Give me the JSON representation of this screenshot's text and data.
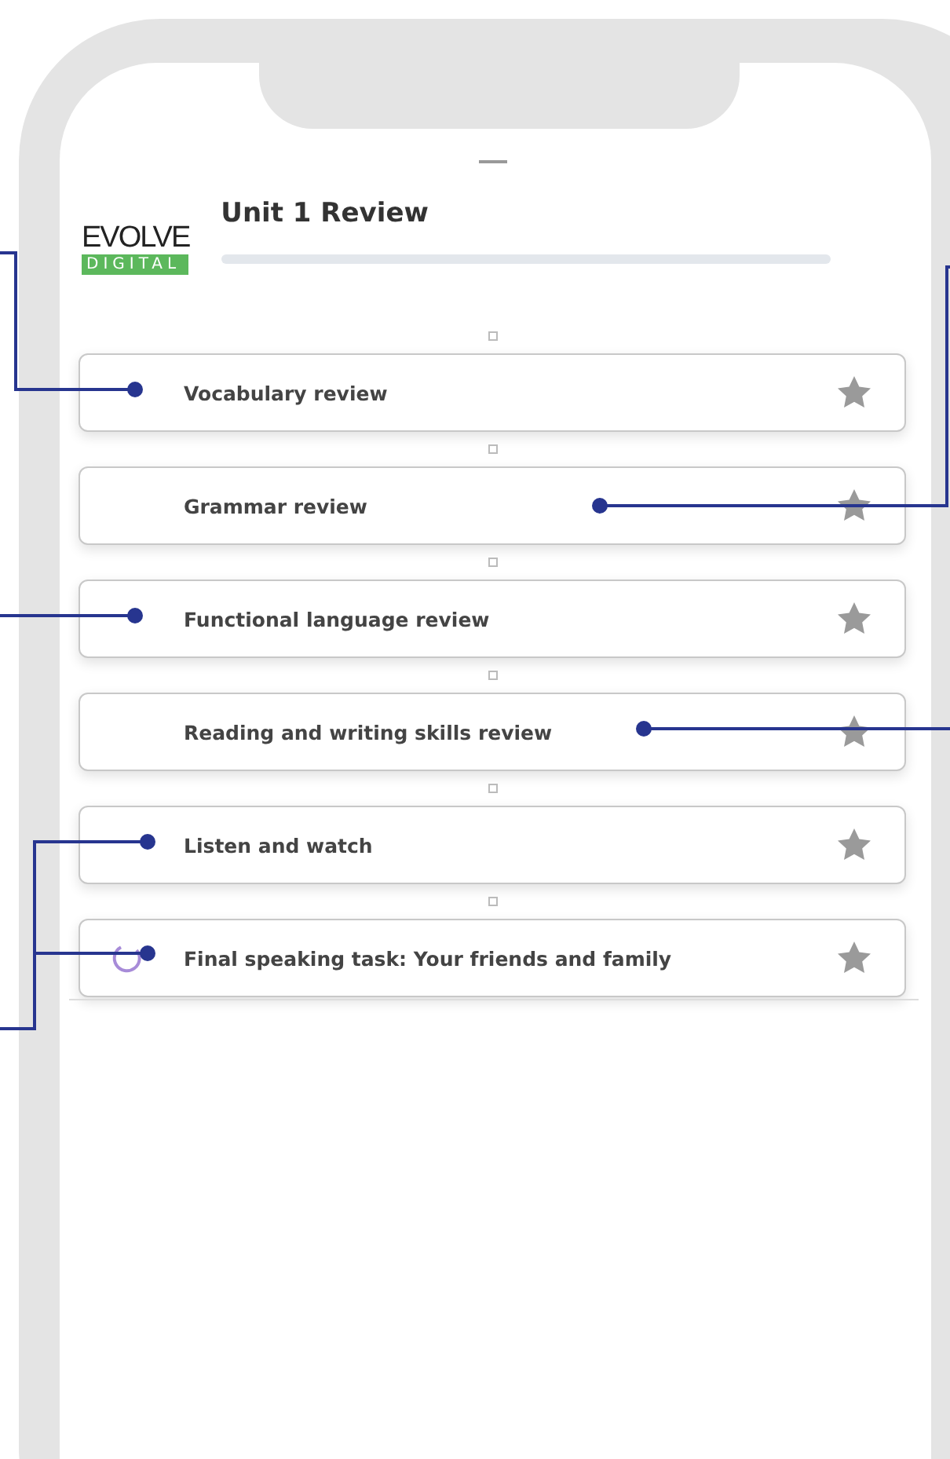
{
  "header": {
    "logo_top": "EVOLVE",
    "logo_bottom": "DIGITAL",
    "title": "Unit 1 Review",
    "progress": {
      "level": 0
    }
  },
  "activities": [
    {
      "title": "Vocabulary review",
      "in_progress": false
    },
    {
      "title": "Grammar review",
      "in_progress": false
    },
    {
      "title": "Functional language review",
      "in_progress": false
    },
    {
      "title": "Reading and writing skills review",
      "in_progress": false
    },
    {
      "title": "Listen and watch",
      "in_progress": false
    },
    {
      "title": "Final speaking task: Your friends and family",
      "in_progress": true
    }
  ]
}
